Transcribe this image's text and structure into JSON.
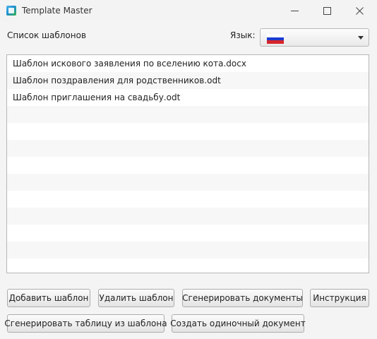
{
  "window": {
    "title": "Template Master",
    "controls": [
      "minimize",
      "maximize",
      "close"
    ]
  },
  "header": {
    "list_label": "Список шаблонов",
    "language_label": "Язык:",
    "language_selected": "Russian flag",
    "flag_colors": [
      "#ffffff",
      "#1c3ccf",
      "#d6242b"
    ]
  },
  "templates": [
    "Шаблон искового заявления по вселению кота.docx",
    "Шаблон поздравления для родственников.odt",
    "Шаблон приглашения на свадьбу.odt"
  ],
  "buttons": {
    "add_template": "Добавить шаблон",
    "delete_template": "Удалить шаблон",
    "generate_documents": "Сгенерировать документы",
    "instructions": "Инструкция",
    "generate_table": "Сгенерировать таблицу из шаблона",
    "create_single_document": "Создать одиночный документ"
  }
}
